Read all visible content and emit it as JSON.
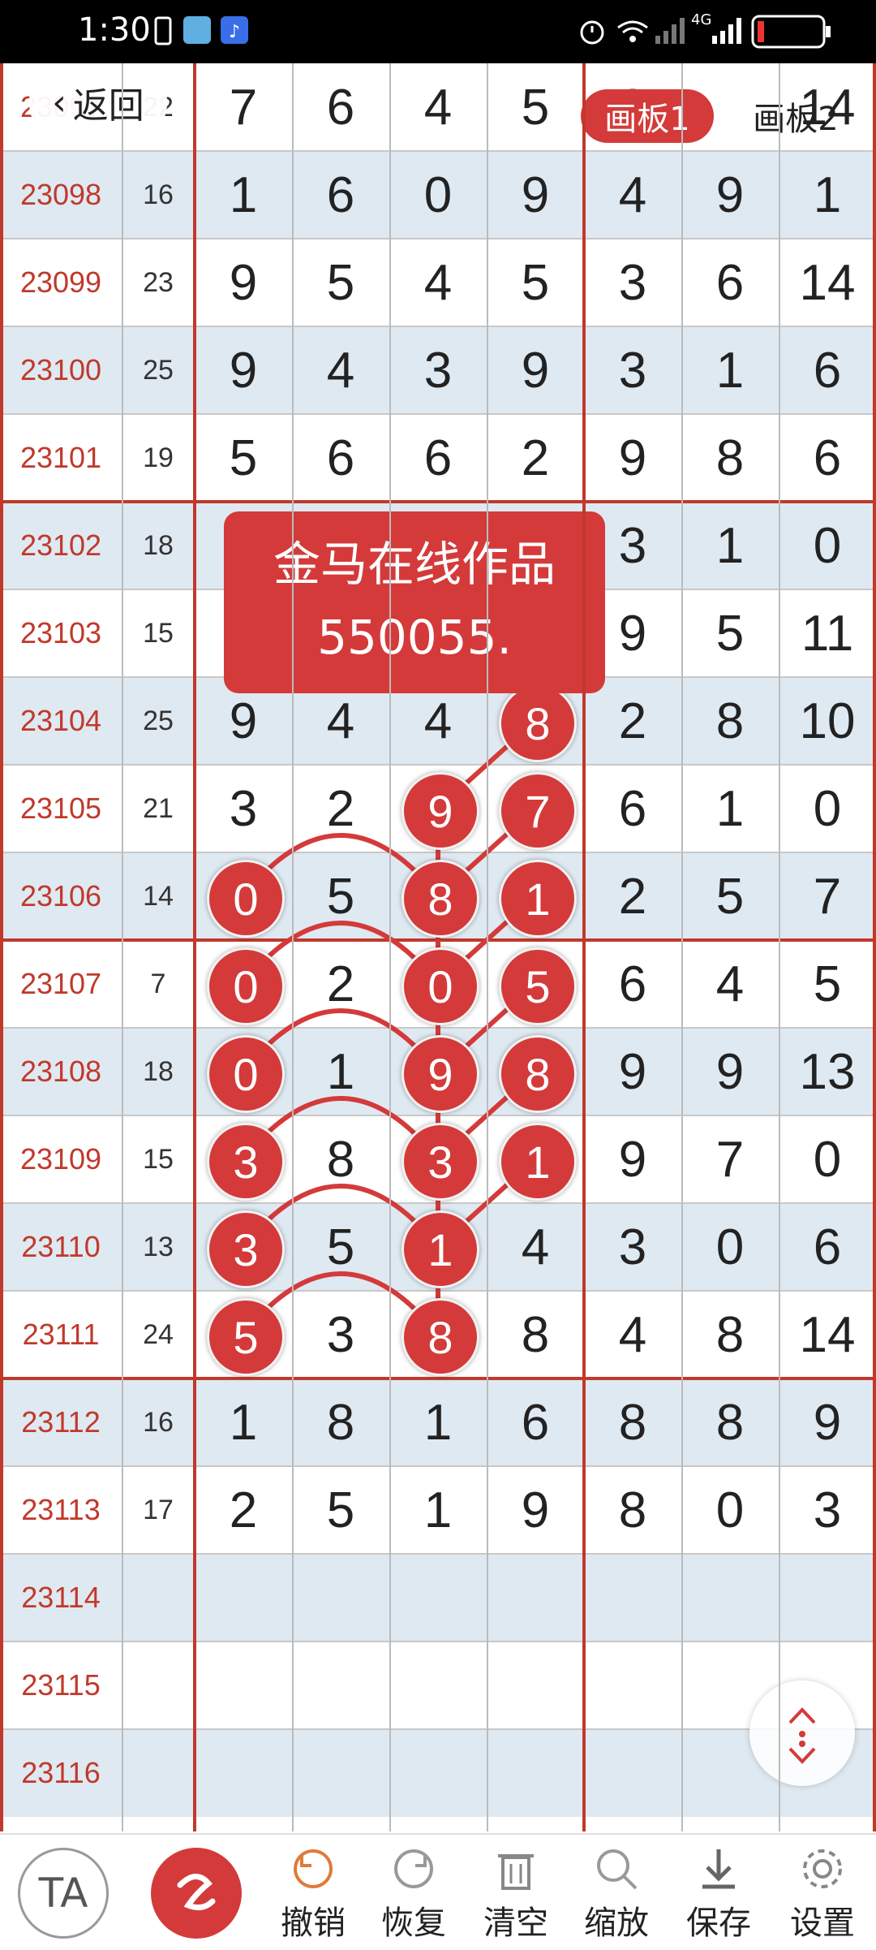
{
  "status_bar": {
    "time": "1:30",
    "network": "4G"
  },
  "navigation": {
    "back_label": "返回"
  },
  "boards": {
    "tab1_label": "画板1",
    "tab2_label": "画板2",
    "active": "画板1"
  },
  "watermark": {
    "line1": "金马在线作品",
    "line2": "550055."
  },
  "rows": [
    {
      "issue": "23097",
      "sum": "22",
      "d1": "7",
      "d2": "6",
      "d3": "4",
      "d4": "5",
      "d5": "3",
      "d6": "",
      "d7": "14"
    },
    {
      "issue": "23098",
      "sum": "16",
      "d1": "1",
      "d2": "6",
      "d3": "0",
      "d4": "9",
      "d5": "4",
      "d6": "9",
      "d7": "1"
    },
    {
      "issue": "23099",
      "sum": "23",
      "d1": "9",
      "d2": "5",
      "d3": "4",
      "d4": "5",
      "d5": "3",
      "d6": "6",
      "d7": "14"
    },
    {
      "issue": "23100",
      "sum": "25",
      "d1": "9",
      "d2": "4",
      "d3": "3",
      "d4": "9",
      "d5": "3",
      "d6": "1",
      "d7": "6"
    },
    {
      "issue": "23101",
      "sum": "19",
      "d1": "5",
      "d2": "6",
      "d3": "6",
      "d4": "2",
      "d5": "9",
      "d6": "8",
      "d7": "6"
    },
    {
      "issue": "23102",
      "sum": "18",
      "d1": "",
      "d2": "",
      "d3": "",
      "d4": "",
      "d5": "3",
      "d6": "1",
      "d7": "0"
    },
    {
      "issue": "23103",
      "sum": "15",
      "d1": "",
      "d2": "",
      "d3": "",
      "d4": "",
      "d5": "9",
      "d6": "5",
      "d7": "11"
    },
    {
      "issue": "23104",
      "sum": "25",
      "d1": "9",
      "d2": "4",
      "d3": "4",
      "d4": "8",
      "d5": "2",
      "d6": "8",
      "d7": "10"
    },
    {
      "issue": "23105",
      "sum": "21",
      "d1": "3",
      "d2": "2",
      "d3": "9",
      "d4": "7",
      "d5": "6",
      "d6": "1",
      "d7": "0"
    },
    {
      "issue": "23106",
      "sum": "14",
      "d1": "0",
      "d2": "5",
      "d3": "8",
      "d4": "1",
      "d5": "2",
      "d6": "5",
      "d7": "7"
    },
    {
      "issue": "23107",
      "sum": "7",
      "d1": "0",
      "d2": "2",
      "d3": "0",
      "d4": "5",
      "d5": "6",
      "d6": "4",
      "d7": "5"
    },
    {
      "issue": "23108",
      "sum": "18",
      "d1": "0",
      "d2": "1",
      "d3": "9",
      "d4": "8",
      "d5": "9",
      "d6": "9",
      "d7": "13"
    },
    {
      "issue": "23109",
      "sum": "15",
      "d1": "3",
      "d2": "8",
      "d3": "3",
      "d4": "1",
      "d5": "9",
      "d6": "7",
      "d7": "0"
    },
    {
      "issue": "23110",
      "sum": "13",
      "d1": "3",
      "d2": "5",
      "d3": "1",
      "d4": "4",
      "d5": "3",
      "d6": "0",
      "d7": "6"
    },
    {
      "issue": "23111",
      "sum": "24",
      "d1": "5",
      "d2": "3",
      "d3": "8",
      "d4": "8",
      "d5": "4",
      "d6": "8",
      "d7": "14"
    },
    {
      "issue": "23112",
      "sum": "16",
      "d1": "1",
      "d2": "8",
      "d3": "1",
      "d4": "6",
      "d5": "8",
      "d6": "8",
      "d7": "9"
    },
    {
      "issue": "23113",
      "sum": "17",
      "d1": "2",
      "d2": "5",
      "d3": "1",
      "d4": "9",
      "d5": "8",
      "d6": "0",
      "d7": "3"
    },
    {
      "issue": "23114",
      "sum": "",
      "d1": "",
      "d2": "",
      "d3": "",
      "d4": "",
      "d5": "",
      "d6": "",
      "d7": ""
    },
    {
      "issue": "23115",
      "sum": "",
      "d1": "",
      "d2": "",
      "d3": "",
      "d4": "",
      "d5": "",
      "d6": "",
      "d7": ""
    },
    {
      "issue": "23116",
      "sum": "",
      "d1": "",
      "d2": "",
      "d3": "",
      "d4": "",
      "d5": "",
      "d6": "",
      "d7": ""
    }
  ],
  "marks": [
    {
      "row": 7,
      "col": 4,
      "value": "8"
    },
    {
      "row": 8,
      "col": 3,
      "value": "9"
    },
    {
      "row": 8,
      "col": 4,
      "value": "7"
    },
    {
      "row": 9,
      "col": 1,
      "value": "0"
    },
    {
      "row": 9,
      "col": 3,
      "value": "8"
    },
    {
      "row": 9,
      "col": 4,
      "value": "1"
    },
    {
      "row": 10,
      "col": 1,
      "value": "0"
    },
    {
      "row": 10,
      "col": 3,
      "value": "0"
    },
    {
      "row": 10,
      "col": 4,
      "value": "5"
    },
    {
      "row": 11,
      "col": 1,
      "value": "0"
    },
    {
      "row": 11,
      "col": 3,
      "value": "9"
    },
    {
      "row": 11,
      "col": 4,
      "value": "8"
    },
    {
      "row": 12,
      "col": 1,
      "value": "3"
    },
    {
      "row": 12,
      "col": 3,
      "value": "3"
    },
    {
      "row": 12,
      "col": 4,
      "value": "1"
    },
    {
      "row": 13,
      "col": 1,
      "value": "3"
    },
    {
      "row": 13,
      "col": 3,
      "value": "1"
    },
    {
      "row": 14,
      "col": 1,
      "value": "5"
    },
    {
      "row": 14,
      "col": 3,
      "value": "8"
    }
  ],
  "toolbar": {
    "text_tool_label": "TA",
    "undo_label": "撤销",
    "redo_label": "恢复",
    "clear_label": "清空",
    "zoom_label": "缩放",
    "save_label": "保存",
    "settings_label": "设置"
  },
  "colors": {
    "accent": "#d43a3a",
    "issue_text": "#c0392b",
    "alt_row": "#dfe9f2"
  }
}
